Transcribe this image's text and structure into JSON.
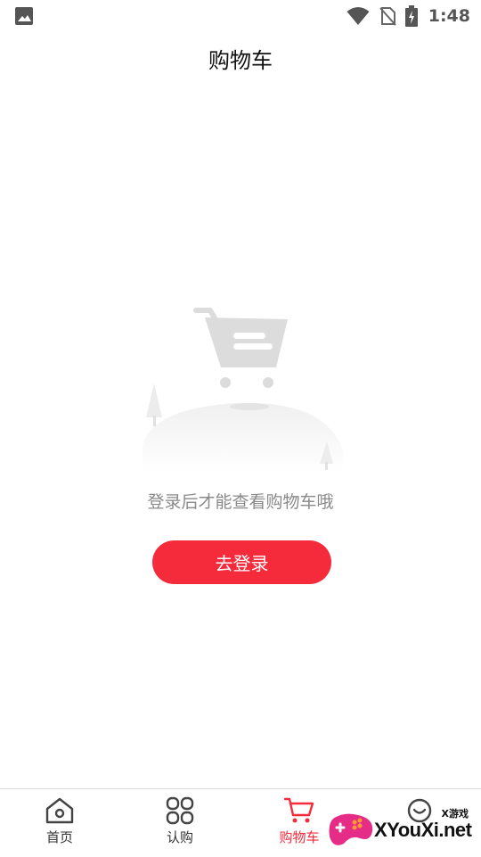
{
  "status_bar": {
    "time": "1:48"
  },
  "header": {
    "title": "购物车"
  },
  "empty_state": {
    "message": "登录后才能查看购物车哦",
    "login_button": "去登录"
  },
  "tabs": [
    {
      "label": "首页",
      "icon": "home-icon",
      "active": false
    },
    {
      "label": "认购",
      "icon": "grid-icon",
      "active": false
    },
    {
      "label": "购物车",
      "icon": "cart-icon",
      "active": true
    },
    {
      "label": "",
      "icon": "profile-icon",
      "active": false
    }
  ],
  "watermark": {
    "top_text": "X游戏",
    "brand": "XYouXi.net"
  },
  "colors": {
    "accent": "#f52a3b",
    "muted_text": "#8a8a8a"
  }
}
